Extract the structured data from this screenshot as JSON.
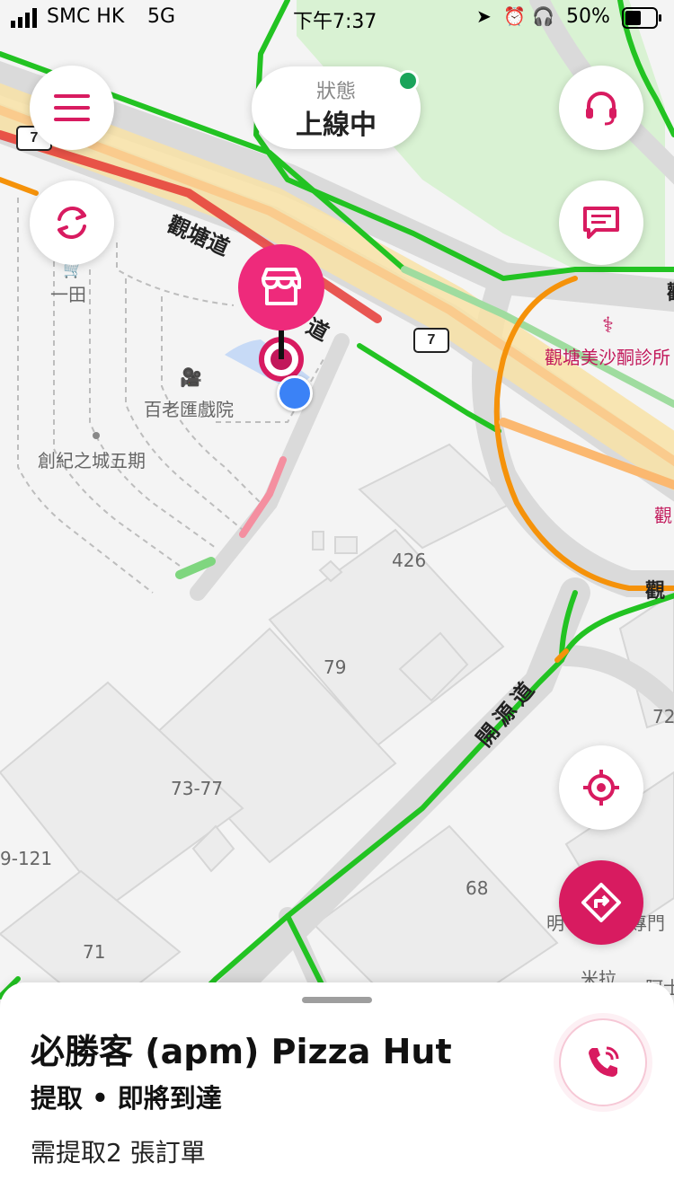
{
  "status_bar": {
    "carrier": "SMC HK",
    "network": "5G",
    "time": "下午7:37",
    "battery": "50%"
  },
  "map": {
    "labels": {
      "ichiban": "一田",
      "cinema": "百老匯戲院",
      "creative_city": "創紀之城五期",
      "clinic": "觀塘美沙酮診所",
      "n426": "426",
      "n79": "79",
      "n7377": "73-77",
      "n121": "9-121",
      "n71": "71",
      "n68": "68",
      "n72": "72",
      "mila": "米拉",
      "ah": "阿士",
      "ming": "明",
      "special": "專門",
      "kwun_edge": "觀",
      "kwun_edge2": "觀",
      "kwun_edge3": "觀"
    },
    "roads": {
      "kwun_tong_road": "觀塘道",
      "dao": "道",
      "hoi_yuen_road": "開源道"
    },
    "route_sign_1": "7",
    "route_sign_2": "7"
  },
  "status_pill": {
    "label": "狀態",
    "value": "上線中"
  },
  "buttons": {
    "menu": "menu-icon",
    "refresh": "refresh-icon",
    "support": "headset-icon",
    "chat": "chat-icon",
    "locate": "crosshair-icon",
    "navigate": "directions-icon"
  },
  "sheet": {
    "title": "必勝客 (apm) Pizza Hut",
    "subtitle": "提取 • 即將到達",
    "description": "需提取2 張訂單"
  },
  "colors": {
    "brand": "#d81b60",
    "traffic_green": "#22c322",
    "traffic_orange": "#f5920a",
    "traffic_red": "#e53935",
    "online_dot": "#1aa45a"
  }
}
